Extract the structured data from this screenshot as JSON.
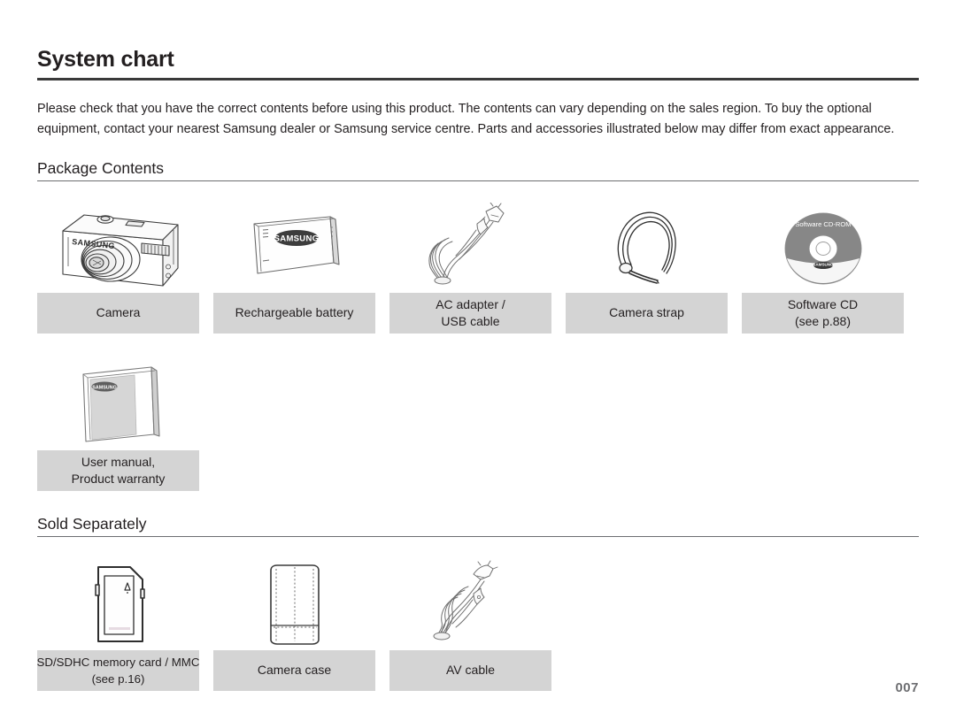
{
  "document": {
    "title": "System chart",
    "intro": "Please check that you have the correct contents before using this product. The contents can vary depending on the sales region. To buy the optional equipment, contact your nearest Samsung dealer or Samsung service centre. Parts and accessories illustrated below may differ from exact appearance.",
    "page_number": "007",
    "brand": "SAMSUNG"
  },
  "sections": [
    {
      "heading": "Package Contents",
      "rows": [
        [
          {
            "icon": "camera-illustration",
            "caption_line1": "Camera",
            "caption_line2": ""
          },
          {
            "icon": "rechargeable-battery-illustration",
            "caption_line1": "Rechargeable battery",
            "caption_line2": ""
          },
          {
            "icon": "ac-adapter-usb-cable-illustration",
            "caption_line1": "AC adapter /",
            "caption_line2": "USB cable"
          },
          {
            "icon": "camera-strap-illustration",
            "caption_line1": "Camera strap",
            "caption_line2": ""
          },
          {
            "icon": "software-cd-illustration",
            "caption_line1": "Software CD",
            "caption_line2": "(see p.88)"
          }
        ],
        [
          {
            "icon": "user-manual-illustration",
            "caption_line1": "User manual,",
            "caption_line2": "Product warranty"
          }
        ]
      ]
    },
    {
      "heading": "Sold Separately",
      "rows": [
        [
          {
            "icon": "sd-memory-card-illustration",
            "caption_line1": "SD/SDHC memory card / MMC",
            "caption_line2": "(see p.16)"
          },
          {
            "icon": "camera-case-illustration",
            "caption_line1": "Camera case",
            "caption_line2": ""
          },
          {
            "icon": "av-cable-illustration",
            "caption_line1": "AV cable",
            "caption_line2": ""
          }
        ]
      ]
    }
  ],
  "labels": {
    "cd_disc_text": "Software CD-ROM"
  },
  "colors": {
    "caption_background": "#d4d4d4",
    "text": "#231f20",
    "rule": "#6d6e71",
    "page_number": "#6d6e71"
  }
}
